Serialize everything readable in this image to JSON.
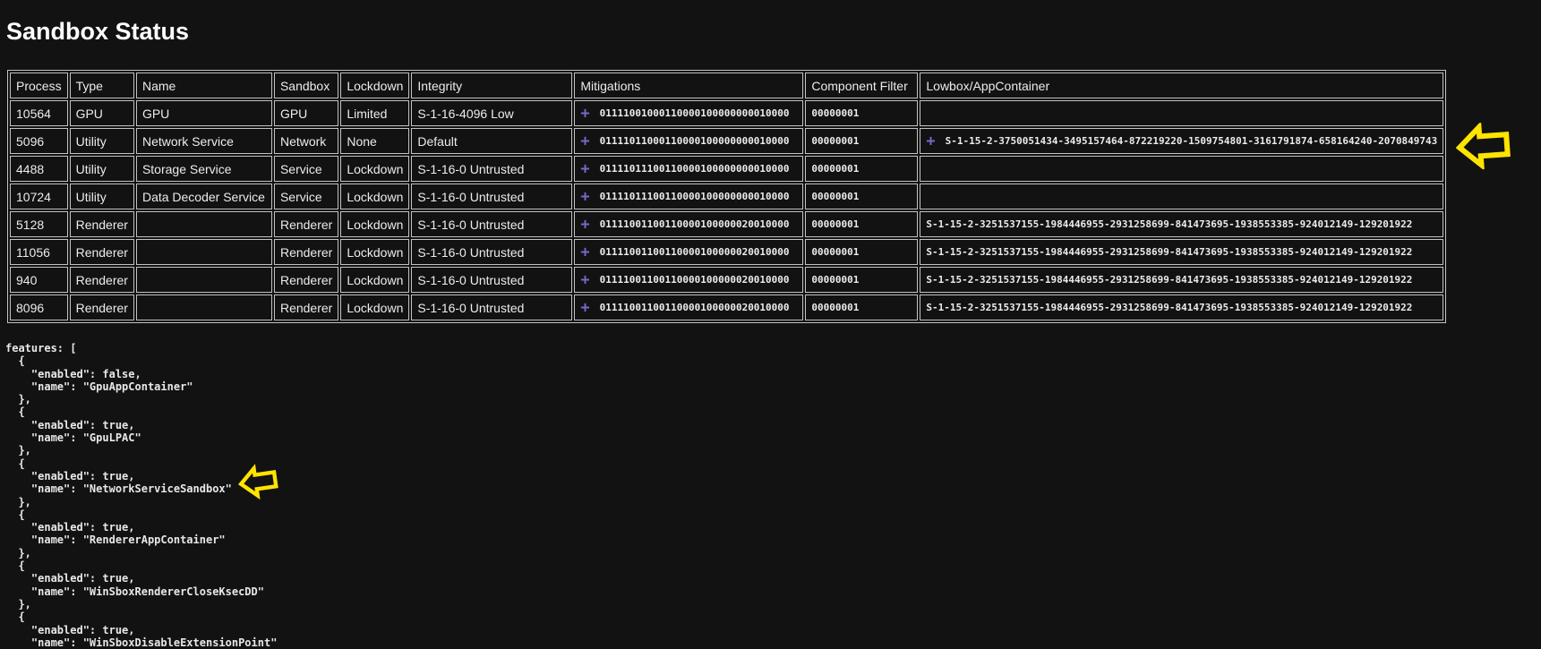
{
  "page": {
    "title": "Sandbox Status"
  },
  "icons": {
    "expand": "+"
  },
  "colors": {
    "arrow": "#ffe400",
    "expand_icon": "#7568c9"
  },
  "table": {
    "columns": [
      "Process",
      "Type",
      "Name",
      "Sandbox",
      "Lockdown",
      "Integrity",
      "Mitigations",
      "Component Filter",
      "Lowbox/AppContainer"
    ],
    "rows": [
      {
        "process": "10564",
        "type": "GPU",
        "name": "GPU",
        "sandbox": "GPU",
        "lockdown": "Limited",
        "integrity": "S-1-16-4096 Low",
        "mitigations": "01111001000110000100000000010000",
        "component_filter": "00000001",
        "lowbox": ""
      },
      {
        "process": "5096",
        "type": "Utility",
        "name": "Network Service",
        "sandbox": "Network",
        "lockdown": "None",
        "integrity": "Default",
        "mitigations": "01111011000110000100000000010000",
        "component_filter": "00000001",
        "lowbox": "S-1-15-2-3750051434-3495157464-872219220-1509754801-3161791874-658164240-2070849743"
      },
      {
        "process": "4488",
        "type": "Utility",
        "name": "Storage Service",
        "sandbox": "Service",
        "lockdown": "Lockdown",
        "integrity": "S-1-16-0 Untrusted",
        "mitigations": "01111011100110000100000000010000",
        "component_filter": "00000001",
        "lowbox": ""
      },
      {
        "process": "10724",
        "type": "Utility",
        "name": "Data Decoder Service",
        "sandbox": "Service",
        "lockdown": "Lockdown",
        "integrity": "S-1-16-0 Untrusted",
        "mitigations": "01111011100110000100000000010000",
        "component_filter": "00000001",
        "lowbox": ""
      },
      {
        "process": "5128",
        "type": "Renderer",
        "name": "",
        "sandbox": "Renderer",
        "lockdown": "Lockdown",
        "integrity": "S-1-16-0 Untrusted",
        "mitigations": "01111001100110000100000020010000",
        "component_filter": "00000001",
        "lowbox": "S-1-15-2-3251537155-1984446955-2931258699-841473695-1938553385-924012149-129201922"
      },
      {
        "process": "11056",
        "type": "Renderer",
        "name": "",
        "sandbox": "Renderer",
        "lockdown": "Lockdown",
        "integrity": "S-1-16-0 Untrusted",
        "mitigations": "01111001100110000100000020010000",
        "component_filter": "00000001",
        "lowbox": "S-1-15-2-3251537155-1984446955-2931258699-841473695-1938553385-924012149-129201922"
      },
      {
        "process": "940",
        "type": "Renderer",
        "name": "",
        "sandbox": "Renderer",
        "lockdown": "Lockdown",
        "integrity": "S-1-16-0 Untrusted",
        "mitigations": "01111001100110000100000020010000",
        "component_filter": "00000001",
        "lowbox": "S-1-15-2-3251537155-1984446955-2931258699-841473695-1938553385-924012149-129201922"
      },
      {
        "process": "8096",
        "type": "Renderer",
        "name": "",
        "sandbox": "Renderer",
        "lockdown": "Lockdown",
        "integrity": "S-1-16-0 Untrusted",
        "mitigations": "01111001100110000100000020010000",
        "component_filter": "00000001",
        "lowbox": "S-1-15-2-3251537155-1984446955-2931258699-841473695-1938553385-924012149-129201922"
      }
    ]
  },
  "features": {
    "text": "features: [\n  {\n    \"enabled\": false,\n    \"name\": \"GpuAppContainer\"\n  },\n  {\n    \"enabled\": true,\n    \"name\": \"GpuLPAC\"\n  },\n  {\n    \"enabled\": true,\n    \"name\": \"NetworkServiceSandbox\"\n  },\n  {\n    \"enabled\": true,\n    \"name\": \"RendererAppContainer\"\n  },\n  {\n    \"enabled\": true,\n    \"name\": \"WinSboxRendererCloseKsecDD\"\n  },\n  {\n    \"enabled\": true,\n    \"name\": \"WinSboxDisableExtensionPoint\""
  }
}
